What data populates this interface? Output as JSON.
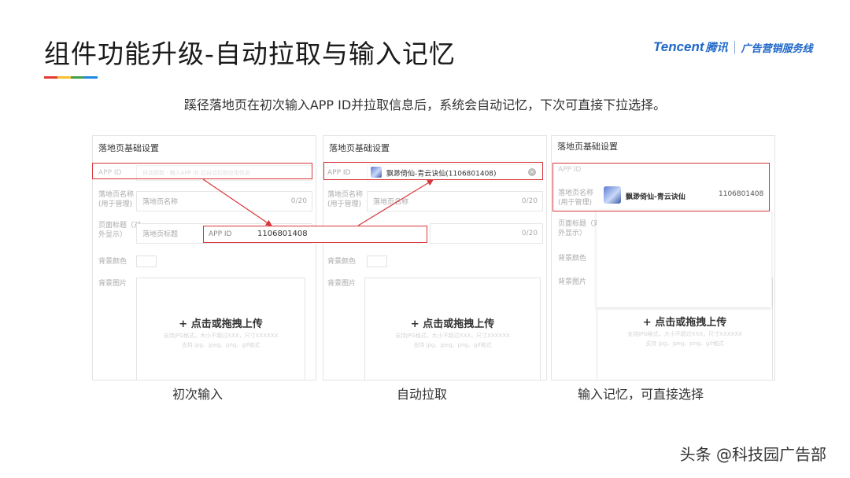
{
  "header": {
    "title": "组件功能升级-自动拉取与输入记忆",
    "accent_colors": [
      "#e53935",
      "#fbc02d",
      "#43a047",
      "#1e88e5"
    ],
    "brand": {
      "name": "Tencent",
      "cn": "腾讯",
      "line": "广告营销服务线",
      "color": "#1f67c8"
    }
  },
  "subtitle": "蹊径落地页在初次输入APP ID并拉取信息后，系统会自动记忆，下次可直接下拉选择。",
  "panels": {
    "first": {
      "heading": "落地页基础设置",
      "appid_label": "APP ID",
      "appid_placeholder": "自动获取 · 输入APP ID 后自动拉取应用信息",
      "name_label": "落地页名称\n(用于管理)",
      "name_placeholder": "落地页名称",
      "name_count": "0/20",
      "pagetitle_label": "页面标题（对\n外显示）",
      "pagetitle_placeholder": "落地页标题",
      "bgcolor_label": "背景颜色",
      "bgimage_label": "背景图片",
      "overlay_label": "APP ID",
      "overlay_value": "1106801408"
    },
    "second": {
      "heading": "落地页基础设置",
      "appid_label": "APP ID",
      "app_name": "飘渺倚仙-青云诀仙(1106801408)",
      "clear_icon": "×",
      "name_label": "落地页名称\n(用于管理)",
      "name_placeholder": "落地页名称",
      "name_count": "0/20",
      "pagetitle_count": "0/20",
      "bgcolor_label": "背景颜色",
      "bgimage_label": "背景图片"
    },
    "third": {
      "heading": "落地页基础设置",
      "appid_label": "APP ID",
      "name_label": "落地页名称\n(用于管理)",
      "option_name": "飘渺倚仙-青云诀仙",
      "option_id": "1106801408",
      "pagetitle_label": "页面标题（对\n外显示）",
      "bgcolor_label": "背景颜色",
      "bgimage_label": "背景图片"
    }
  },
  "upload": {
    "label": "+ 点击或拖拽上传",
    "hint_1": "支持JPG格式，大小不超过XXX，尺寸XXXXXX",
    "hint_2": "支持 jpg、jpeg、png、gif格式"
  },
  "captions": [
    "初次输入",
    "自动拉取",
    "输入记忆，可直接选择"
  ],
  "footer": "头条 @科技园广告部"
}
